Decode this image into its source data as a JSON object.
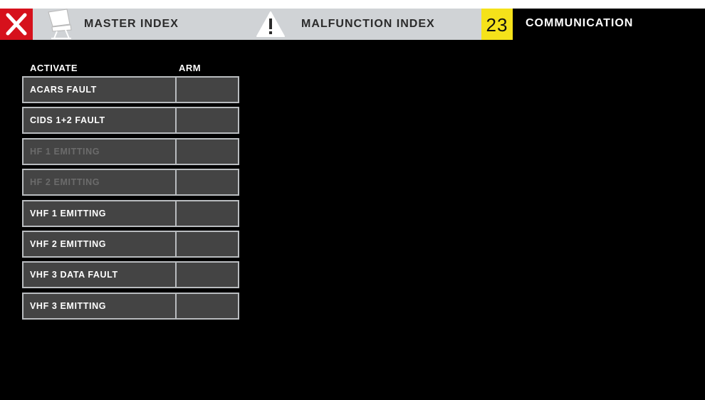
{
  "header": {
    "close_icon": "close-x-icon",
    "master_index": {
      "label": "MASTER INDEX",
      "icon": "aircraft-seat-icon"
    },
    "malfunction_index": {
      "label": "MALFUNCTION INDEX",
      "icon": "warning-triangle-icon"
    },
    "chapter": {
      "number": "23",
      "title": "COMMUNICATION"
    }
  },
  "columns": {
    "activate": "ACTIVATE",
    "arm": "ARM"
  },
  "malfunctions": [
    {
      "label": "ACARS FAULT",
      "enabled": true
    },
    {
      "label": "CIDS 1+2 FAULT",
      "enabled": true
    },
    {
      "label": "HF 1 EMITTING",
      "enabled": false
    },
    {
      "label": "HF 2 EMITTING",
      "enabled": false
    },
    {
      "label": "VHF 1 EMITTING",
      "enabled": true
    },
    {
      "label": "VHF 2 EMITTING",
      "enabled": true
    },
    {
      "label": "VHF 3 DATA FAULT",
      "enabled": true
    },
    {
      "label": "VHF 3 EMITTING",
      "enabled": true
    }
  ],
  "colors": {
    "close": "#d6111c",
    "chapter_badge": "#f5e21a",
    "topbar": "#d0d3d6",
    "button_fill": "#444444",
    "button_border": "#b9bcbf",
    "disabled_text": "#6b6b6b"
  }
}
